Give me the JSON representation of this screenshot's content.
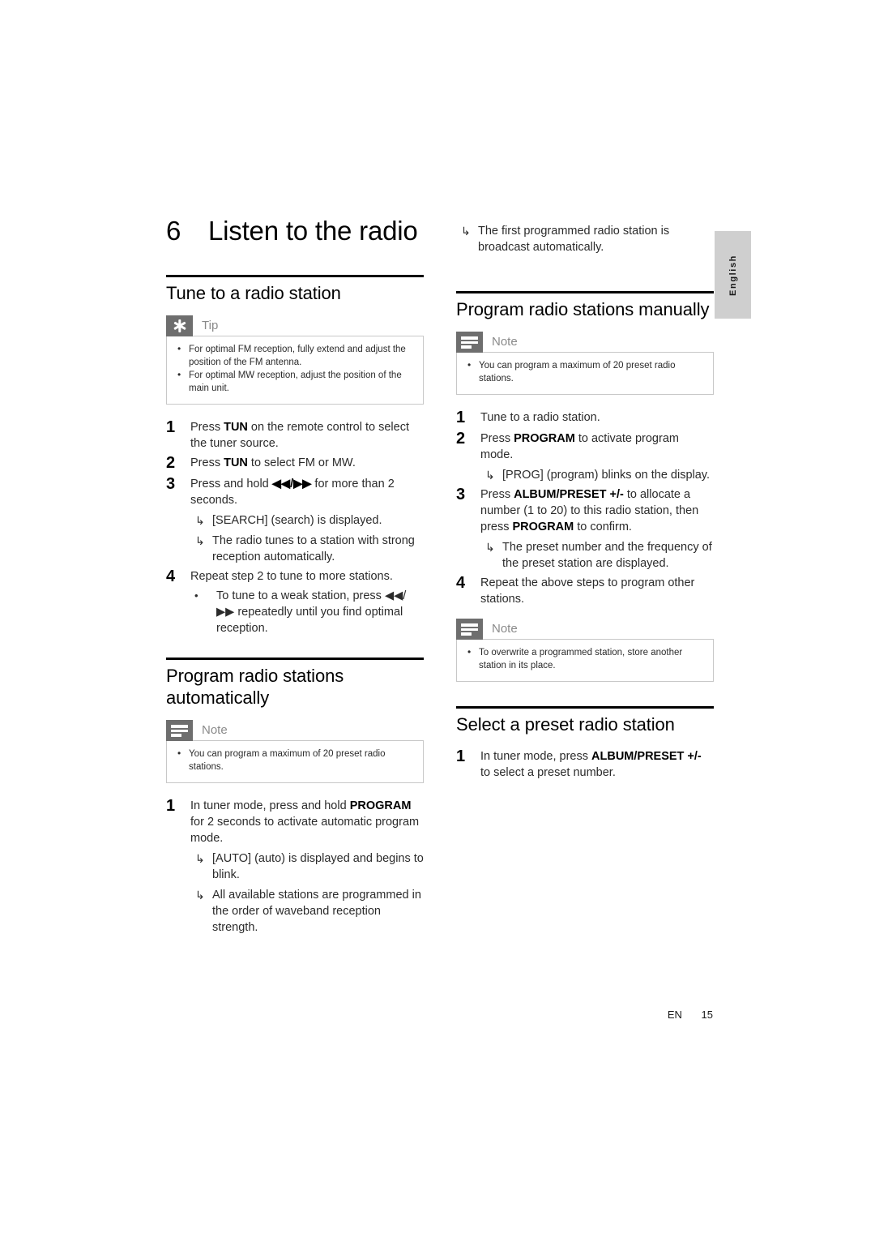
{
  "document": {
    "language_tab": "English",
    "footer": {
      "language_code": "EN",
      "page_number": "15"
    }
  },
  "chapter": {
    "number": "6",
    "title": "Listen to the radio"
  },
  "left_column": {
    "section1": {
      "title": "Tune to a radio station",
      "callout": {
        "type": "tip",
        "icon": "tip-asterisk-icon",
        "label": "Tip",
        "items": [
          "For optimal FM reception, fully extend and adjust the position of the FM antenna.",
          "For optimal MW reception, adjust the position of the main unit."
        ]
      },
      "steps": [
        {
          "number": "1",
          "text_parts": [
            {
              "text": "Press ",
              "bold": false
            },
            {
              "text": "TUN",
              "bold": true
            },
            {
              "text": " on the remote control to select the tuner source.",
              "bold": false
            }
          ]
        },
        {
          "number": "2",
          "text_parts": [
            {
              "text": "Press ",
              "bold": false
            },
            {
              "text": "TUN",
              "bold": true
            },
            {
              "text": " to select FM or MW.",
              "bold": false
            }
          ]
        },
        {
          "number": "3",
          "text_parts": [
            {
              "text": "Press and hold ",
              "bold": false
            },
            {
              "text": "◀◀/▶▶",
              "bold": true
            },
            {
              "text": " for more than 2 seconds.",
              "bold": false
            }
          ],
          "results": [
            "[SEARCH] (search) is displayed.",
            "The radio tunes to a station with strong reception automatically."
          ]
        },
        {
          "number": "4",
          "text_parts": [
            {
              "text": "Repeat step 2 to tune to more stations.",
              "bold": false
            }
          ],
          "bullets": [
            "To tune to a weak station, press ◀◀/▶▶ repeatedly until you find optimal reception."
          ]
        }
      ]
    },
    "section2": {
      "title": "Program radio stations automatically",
      "callout": {
        "type": "note",
        "icon": "note-lines-icon",
        "label": "Note",
        "items": [
          "You can program a maximum of 20 preset radio stations."
        ]
      },
      "steps": [
        {
          "number": "1",
          "text_parts": [
            {
              "text": "In tuner mode, press and hold ",
              "bold": false
            },
            {
              "text": "PROGRAM",
              "bold": true
            },
            {
              "text": " for 2 seconds to activate automatic program mode.",
              "bold": false
            }
          ],
          "results": [
            "[AUTO] (auto) is displayed and begins to blink.",
            "All available stations are programmed in the order of waveband reception strength."
          ]
        }
      ]
    }
  },
  "right_column": {
    "continued_result": "The first programmed radio station is broadcast automatically.",
    "section1": {
      "title": "Program radio stations manually",
      "callout": {
        "type": "note",
        "icon": "note-lines-icon",
        "label": "Note",
        "items": [
          "You can program a maximum of 20 preset radio stations."
        ]
      },
      "steps": [
        {
          "number": "1",
          "text_parts": [
            {
              "text": "Tune to a radio station.",
              "bold": false
            }
          ]
        },
        {
          "number": "2",
          "text_parts": [
            {
              "text": "Press ",
              "bold": false
            },
            {
              "text": "PROGRAM",
              "bold": true
            },
            {
              "text": " to activate program mode.",
              "bold": false
            }
          ],
          "results": [
            "[PROG] (program) blinks on the display."
          ]
        },
        {
          "number": "3",
          "text_parts": [
            {
              "text": "Press ",
              "bold": false
            },
            {
              "text": "ALBUM/PRESET +/-",
              "bold": true
            },
            {
              "text": " to allocate a number (1 to 20) to this radio station, then press ",
              "bold": false
            },
            {
              "text": "PROGRAM",
              "bold": true
            },
            {
              "text": " to confirm.",
              "bold": false
            }
          ],
          "results": [
            "The preset number and the frequency of the preset station are displayed."
          ]
        },
        {
          "number": "4",
          "text_parts": [
            {
              "text": "Repeat the above steps to program other stations.",
              "bold": false
            }
          ]
        }
      ],
      "callout2": {
        "type": "note",
        "icon": "note-lines-icon",
        "label": "Note",
        "items": [
          "To overwrite a programmed station, store another station in its place."
        ]
      }
    },
    "section2": {
      "title": "Select a preset radio station",
      "steps": [
        {
          "number": "1",
          "text_parts": [
            {
              "text": "In tuner mode, press ",
              "bold": false
            },
            {
              "text": "ALBUM/PRESET +/-",
              "bold": true
            },
            {
              "text": " to select a preset number.",
              "bold": false
            }
          ]
        }
      ]
    }
  },
  "glyphs": {
    "result_arrow": "↳",
    "bullet_dot": "•"
  }
}
